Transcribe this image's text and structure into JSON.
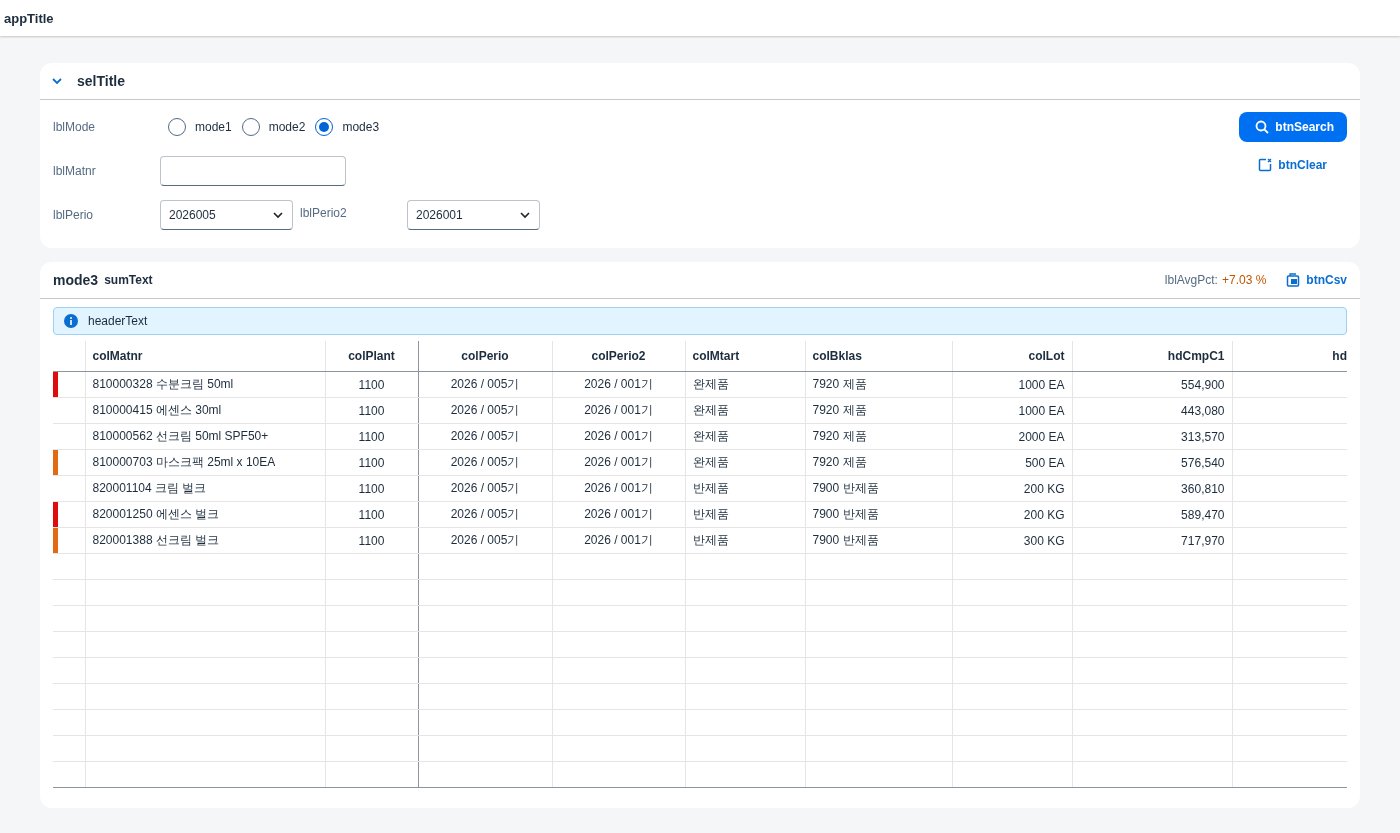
{
  "app_title": "appTitle",
  "selection": {
    "title": "selTitle",
    "expanded": true,
    "mode": {
      "label": "lblMode",
      "options": [
        {
          "label": "mode1",
          "selected": false
        },
        {
          "label": "mode2",
          "selected": false
        },
        {
          "label": "mode3",
          "selected": true
        }
      ]
    },
    "matnr": {
      "label": "lblMatnr"
    },
    "perio": {
      "label": "lblPerio",
      "value": "2026005"
    },
    "perio2": {
      "label": "lblPerio2",
      "value": "2026001"
    },
    "search_button": "btnSearch",
    "clear_button": "btnClear"
  },
  "results": {
    "mode": "mode3",
    "sum_text": "sumText",
    "avg_label": "lblAvgPct:",
    "avg_value": "+7.03 %",
    "csv_button": "btnCsv",
    "info": "headerText",
    "columns": [
      "colMatnr",
      "colPlant",
      "colPerio",
      "colPerio2",
      "colMtart",
      "colBklas",
      "colLot",
      "hdCmpC1",
      "hd"
    ],
    "rows": [
      {
        "color": "#e00b0b",
        "cells": [
          "810000328 수분크림 50ml",
          "1100",
          "2026 / 005기",
          "2026 / 001기",
          "완제품",
          "7920 제품",
          "1000 EA",
          "554,900"
        ]
      },
      {
        "cells": [
          "810000415 에센스 30ml",
          "1100",
          "2026 / 005기",
          "2026 / 001기",
          "완제품",
          "7920 제품",
          "1000 EA",
          "443,080"
        ]
      },
      {
        "cells": [
          "810000562 선크림 50ml SPF50+",
          "1100",
          "2026 / 005기",
          "2026 / 001기",
          "완제품",
          "7920 제품",
          "2000 EA",
          "313,570"
        ]
      },
      {
        "color": "#e26a12",
        "cells": [
          "810000703 마스크팩 25ml x 10EA",
          "1100",
          "2026 / 005기",
          "2026 / 001기",
          "완제품",
          "7920 제품",
          "500 EA",
          "576,540"
        ]
      },
      {
        "cells": [
          "820001104 크림 벌크",
          "1100",
          "2026 / 005기",
          "2026 / 001기",
          "반제품",
          "7900 반제품",
          "200 KG",
          "360,810"
        ]
      },
      {
        "color": "#e00b0b",
        "cells": [
          "820001250 에센스 벌크",
          "1100",
          "2026 / 005기",
          "2026 / 001기",
          "반제품",
          "7900 반제품",
          "200 KG",
          "589,470"
        ]
      },
      {
        "color": "#e26a12",
        "cells": [
          "820001388 선크림 벌크",
          "1100",
          "2026 / 005기",
          "2026 / 001기",
          "반제품",
          "7900 반제품",
          "300 KG",
          "717,970"
        ]
      }
    ]
  }
}
